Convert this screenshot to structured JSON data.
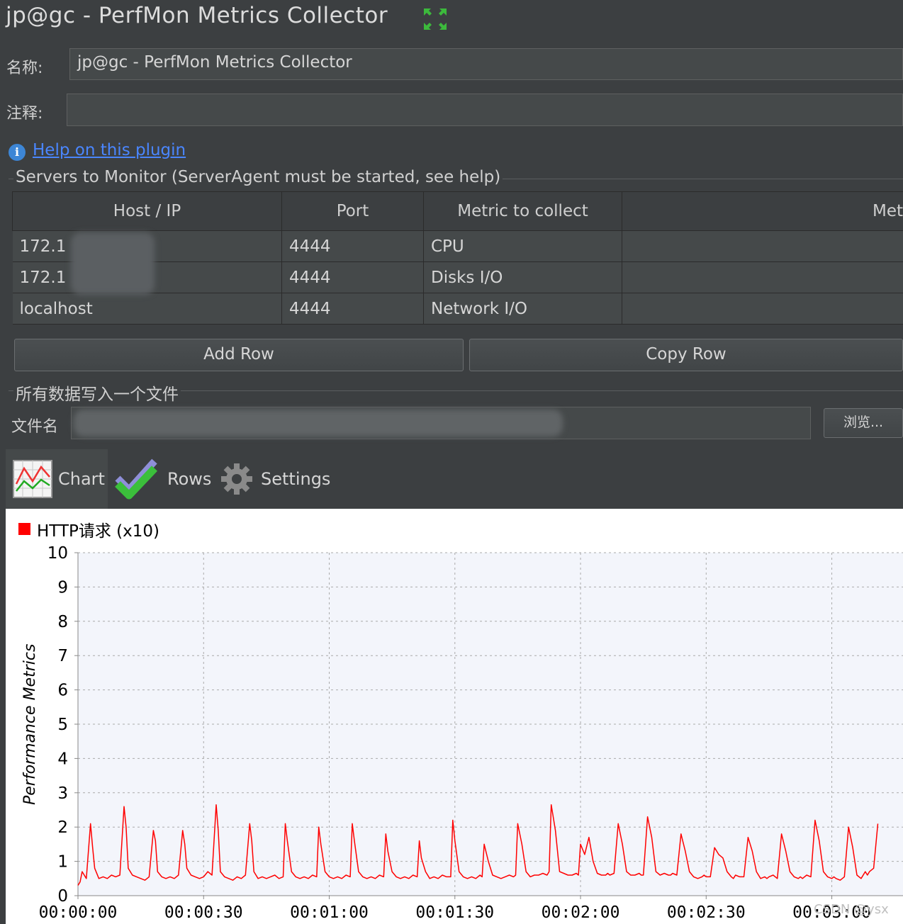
{
  "window": {
    "title": "jp@gc - PerfMon Metrics Collector"
  },
  "form": {
    "name_label": "名称:",
    "name_value": "jp@gc - PerfMon Metrics Collector",
    "comment_label": "注释:",
    "comment_value": ""
  },
  "help": {
    "icon": "info-icon",
    "link_text": "Help on this plugin"
  },
  "servers": {
    "section_title": "Servers to Monitor (ServerAgent must be started, see help)",
    "columns": [
      "Host / IP",
      "Port",
      "Metric to collect",
      "Met"
    ],
    "rows": [
      {
        "host": "172.1",
        "port": "4444",
        "metric": "CPU",
        "params": ""
      },
      {
        "host": "172.1",
        "port": "4444",
        "metric": "Disks I/O",
        "params": ""
      },
      {
        "host": "localhost",
        "port": "4444",
        "metric": "Network I/O",
        "params": ""
      }
    ],
    "add_row_label": "Add Row",
    "copy_row_label": "Copy Row"
  },
  "file": {
    "section_title": "所有数据写入一个文件",
    "label": "文件名",
    "value": "",
    "browse_label": "浏览..."
  },
  "tabs": [
    {
      "label": "Chart",
      "icon": "chart-icon",
      "active": true
    },
    {
      "label": "Rows",
      "icon": "checkmark-icon",
      "active": false
    },
    {
      "label": "Settings",
      "icon": "gear-icon",
      "active": false
    }
  ],
  "colors": {
    "background": "#3c3f41",
    "link": "#4a86ff",
    "series": "#ff0000",
    "expand_icon": "#3cba3c"
  },
  "watermark": "CSDN @ysx",
  "chart_data": {
    "type": "line",
    "title": "",
    "xlabel": "",
    "ylabel": "Performance Metrics",
    "ylim": [
      0,
      10
    ],
    "y_ticks": [
      "0",
      "1",
      "2",
      "3",
      "4",
      "5",
      "6",
      "7",
      "8",
      "9",
      "10"
    ],
    "xlim_seconds": [
      0,
      197
    ],
    "x_ticks": [
      "00:00:00",
      "00:00:30",
      "00:01:00",
      "00:01:30",
      "00:02:00",
      "00:02:30",
      "00:03:00"
    ],
    "grid": true,
    "legend_position": "top-left",
    "series": [
      {
        "name": "HTTP请求 (x10)",
        "color": "#ff0000",
        "x_seconds": [
          0,
          0.5,
          1,
          2,
          3,
          3.5,
          4,
          5,
          6,
          7,
          8,
          9,
          10,
          11,
          11.5,
          12,
          13,
          14,
          15,
          16,
          17,
          18,
          18.5,
          19,
          20,
          21,
          22,
          23,
          24,
          25,
          25.5,
          26,
          27,
          28,
          29,
          30,
          31,
          32,
          33,
          33.5,
          34,
          35,
          36,
          37,
          38,
          39,
          40,
          41,
          41.5,
          42,
          43,
          44,
          45,
          46,
          47,
          48,
          49,
          49.5,
          50,
          51,
          52,
          53,
          54,
          55,
          56,
          57,
          57.5,
          58,
          59,
          60,
          61,
          62,
          63,
          64,
          65,
          65.5,
          66,
          67,
          68,
          69,
          70,
          71,
          72,
          73,
          73.5,
          74,
          75,
          76,
          77,
          78,
          79,
          80,
          81,
          81.5,
          82,
          83,
          84,
          85,
          86,
          87,
          88,
          89,
          89.5,
          90,
          91,
          92,
          93,
          94,
          95,
          96,
          96.5,
          97,
          98,
          99,
          100,
          101,
          102,
          103,
          104,
          104.5,
          105,
          106,
          107,
          108,
          109,
          110,
          111,
          112,
          112.5,
          113,
          114,
          115,
          116,
          117,
          118,
          119,
          119.5,
          120,
          121,
          122,
          123,
          124,
          125,
          126,
          126.5,
          127,
          128,
          129,
          130,
          131,
          132,
          133,
          134,
          134.5,
          135,
          136,
          137,
          138,
          139,
          140,
          141,
          141.5,
          142,
          143,
          144,
          145,
          146,
          147,
          148,
          149,
          149.5,
          150,
          151,
          152,
          153,
          154,
          155,
          156,
          156.5,
          157,
          158,
          159,
          160,
          161,
          162,
          163,
          164,
          164.5,
          165,
          166,
          167,
          168,
          169,
          170,
          171,
          172,
          172.5,
          173,
          174,
          175,
          176,
          177,
          178,
          179,
          180,
          180.5,
          181,
          182,
          183,
          184,
          185,
          186,
          187,
          188,
          188.5,
          189,
          190,
          191,
          192,
          193,
          194,
          195,
          196,
          197
        ],
        "values": [
          0.3,
          0.4,
          0.7,
          0.5,
          2.1,
          1.4,
          0.8,
          0.5,
          0.55,
          0.5,
          0.6,
          0.55,
          0.6,
          2.6,
          2.0,
          0.8,
          0.6,
          0.55,
          0.5,
          0.45,
          0.55,
          1.9,
          1.6,
          0.7,
          0.55,
          0.5,
          0.55,
          0.5,
          0.6,
          1.9,
          1.5,
          0.8,
          0.6,
          0.55,
          0.5,
          0.55,
          0.7,
          0.6,
          2.65,
          1.9,
          0.7,
          0.55,
          0.5,
          0.45,
          0.55,
          0.5,
          0.6,
          2.1,
          1.6,
          0.7,
          0.5,
          0.55,
          0.5,
          0.55,
          0.6,
          0.5,
          0.55,
          2.1,
          1.6,
          0.7,
          0.55,
          0.5,
          0.55,
          0.5,
          0.6,
          0.55,
          2.0,
          1.5,
          0.7,
          0.55,
          0.5,
          0.55,
          0.5,
          0.6,
          0.55,
          2.1,
          1.6,
          0.7,
          0.55,
          0.5,
          0.55,
          0.5,
          0.6,
          0.55,
          1.8,
          1.3,
          0.7,
          0.55,
          0.5,
          0.55,
          0.5,
          0.6,
          0.55,
          1.6,
          1.1,
          0.7,
          0.5,
          0.55,
          0.5,
          0.6,
          0.55,
          0.55,
          2.2,
          1.6,
          0.7,
          0.55,
          0.5,
          0.55,
          0.5,
          0.6,
          0.55,
          1.5,
          1.0,
          0.6,
          0.55,
          0.5,
          0.55,
          0.6,
          0.55,
          0.6,
          2.1,
          1.5,
          0.7,
          0.55,
          0.6,
          0.6,
          0.65,
          0.6,
          0.7,
          2.65,
          1.9,
          0.7,
          0.65,
          0.6,
          0.6,
          0.65,
          0.6,
          1.5,
          1.2,
          1.7,
          1.0,
          0.65,
          0.6,
          0.6,
          0.65,
          0.6,
          0.65,
          2.1,
          1.5,
          0.7,
          0.6,
          0.6,
          0.65,
          0.6,
          0.6,
          2.3,
          1.7,
          0.7,
          0.6,
          0.65,
          0.6,
          0.6,
          0.65,
          0.6,
          1.8,
          1.3,
          0.7,
          0.55,
          0.5,
          0.55,
          0.6,
          0.55,
          0.55,
          1.4,
          1.2,
          1.1,
          0.7,
          0.55,
          0.5,
          0.6,
          0.55,
          0.55,
          1.7,
          1.3,
          0.7,
          0.5,
          0.55,
          0.5,
          0.55,
          0.6,
          0.5,
          1.8,
          1.3,
          0.7,
          0.55,
          0.5,
          0.55,
          0.5,
          0.6,
          0.55,
          2.2,
          1.6,
          0.7,
          0.55,
          0.5,
          0.55,
          0.5,
          0.45,
          0.55,
          2.0,
          1.4,
          0.6,
          0.5,
          0.7,
          0.6,
          0.7,
          0.8,
          2.1
        ]
      }
    ]
  }
}
